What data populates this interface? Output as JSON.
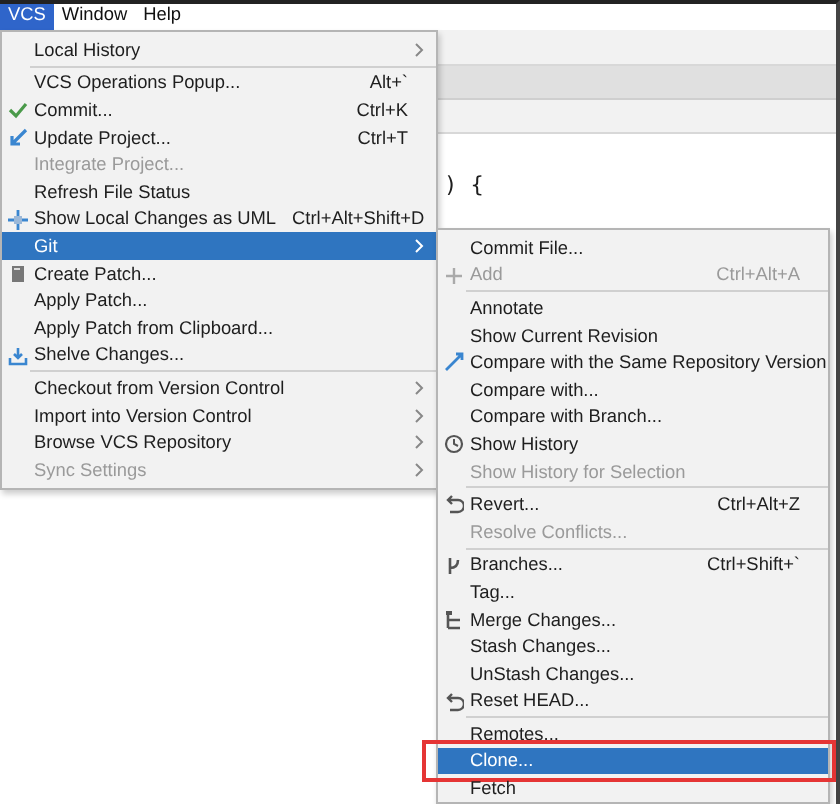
{
  "menubar": [
    {
      "label": "VCS",
      "selected": true
    },
    {
      "label": "Window",
      "selected": false
    },
    {
      "label": "Help",
      "selected": false
    }
  ],
  "editor": {
    "code_fragment": ") {"
  },
  "vcs_menu": {
    "items": [
      {
        "kind": "item",
        "label": "Local History",
        "submenu": true,
        "disabled": false,
        "selected": false
      },
      {
        "kind": "separator"
      },
      {
        "kind": "item",
        "label": "VCS Operations Popup...",
        "shortcut": "Alt+`",
        "submenu": false,
        "disabled": false,
        "selected": false
      },
      {
        "kind": "item",
        "label": "Commit...",
        "shortcut": "Ctrl+K",
        "submenu": false,
        "disabled": false,
        "selected": false
      },
      {
        "kind": "item",
        "label": "Update Project...",
        "shortcut": "Ctrl+T",
        "submenu": false,
        "disabled": false,
        "selected": false
      },
      {
        "kind": "item",
        "label": "Integrate Project...",
        "submenu": false,
        "disabled": true,
        "selected": false
      },
      {
        "kind": "item",
        "label": "Refresh File Status",
        "submenu": false,
        "disabled": false,
        "selected": false
      },
      {
        "kind": "item",
        "label": "Show Local Changes as UML",
        "shortcut": "Ctrl+Alt+Shift+D",
        "submenu": false,
        "disabled": false,
        "selected": false
      },
      {
        "kind": "item",
        "label": "Git",
        "submenu": true,
        "disabled": false,
        "selected": true
      },
      {
        "kind": "item",
        "label": "Create Patch...",
        "submenu": false,
        "disabled": false,
        "selected": false
      },
      {
        "kind": "item",
        "label": "Apply Patch...",
        "submenu": false,
        "disabled": false,
        "selected": false
      },
      {
        "kind": "item",
        "label": "Apply Patch from Clipboard...",
        "submenu": false,
        "disabled": false,
        "selected": false
      },
      {
        "kind": "item",
        "label": "Shelve Changes...",
        "submenu": false,
        "disabled": false,
        "selected": false
      },
      {
        "kind": "separator"
      },
      {
        "kind": "item",
        "label": "Checkout from Version Control",
        "submenu": true,
        "disabled": false,
        "selected": false
      },
      {
        "kind": "item",
        "label": "Import into Version Control",
        "submenu": true,
        "disabled": false,
        "selected": false
      },
      {
        "kind": "item",
        "label": "Browse VCS Repository",
        "submenu": true,
        "disabled": false,
        "selected": false
      },
      {
        "kind": "item",
        "label": "Sync Settings",
        "submenu": true,
        "disabled": true,
        "selected": false
      }
    ]
  },
  "git_menu": {
    "items": [
      {
        "kind": "item",
        "label": "Commit File...",
        "submenu": false,
        "disabled": false,
        "selected": false
      },
      {
        "kind": "item",
        "label": "Add",
        "shortcut": "Ctrl+Alt+A",
        "submenu": false,
        "disabled": true,
        "selected": false
      },
      {
        "kind": "separator"
      },
      {
        "kind": "item",
        "label": "Annotate",
        "submenu": false,
        "disabled": false,
        "selected": false
      },
      {
        "kind": "item",
        "label": "Show Current Revision",
        "submenu": false,
        "disabled": false,
        "selected": false
      },
      {
        "kind": "item",
        "label": "Compare with the Same Repository Version",
        "submenu": false,
        "disabled": false,
        "selected": false
      },
      {
        "kind": "item",
        "label": "Compare with...",
        "submenu": false,
        "disabled": false,
        "selected": false
      },
      {
        "kind": "item",
        "label": "Compare with Branch...",
        "submenu": false,
        "disabled": false,
        "selected": false
      },
      {
        "kind": "item",
        "label": "Show History",
        "submenu": false,
        "disabled": false,
        "selected": false
      },
      {
        "kind": "item",
        "label": "Show History for Selection",
        "submenu": false,
        "disabled": true,
        "selected": false
      },
      {
        "kind": "separator"
      },
      {
        "kind": "item",
        "label": "Revert...",
        "shortcut": "Ctrl+Alt+Z",
        "submenu": false,
        "disabled": false,
        "selected": false
      },
      {
        "kind": "item",
        "label": "Resolve Conflicts...",
        "submenu": false,
        "disabled": true,
        "selected": false
      },
      {
        "kind": "separator"
      },
      {
        "kind": "item",
        "label": "Branches...",
        "shortcut": "Ctrl+Shift+`",
        "submenu": false,
        "disabled": false,
        "selected": false
      },
      {
        "kind": "item",
        "label": "Tag...",
        "submenu": false,
        "disabled": false,
        "selected": false
      },
      {
        "kind": "item",
        "label": "Merge Changes...",
        "submenu": false,
        "disabled": false,
        "selected": false
      },
      {
        "kind": "item",
        "label": "Stash Changes...",
        "submenu": false,
        "disabled": false,
        "selected": false
      },
      {
        "kind": "item",
        "label": "UnStash Changes...",
        "submenu": false,
        "disabled": false,
        "selected": false
      },
      {
        "kind": "item",
        "label": "Reset HEAD...",
        "submenu": false,
        "disabled": false,
        "selected": false
      },
      {
        "kind": "separator"
      },
      {
        "kind": "item",
        "label": "Remotes...",
        "submenu": false,
        "disabled": false,
        "selected": false
      },
      {
        "kind": "item",
        "label": "Clone...",
        "submenu": false,
        "disabled": false,
        "selected": true,
        "annotated": true
      },
      {
        "kind": "item",
        "label": "Fetch",
        "submenu": false,
        "disabled": false,
        "selected": false
      }
    ]
  }
}
